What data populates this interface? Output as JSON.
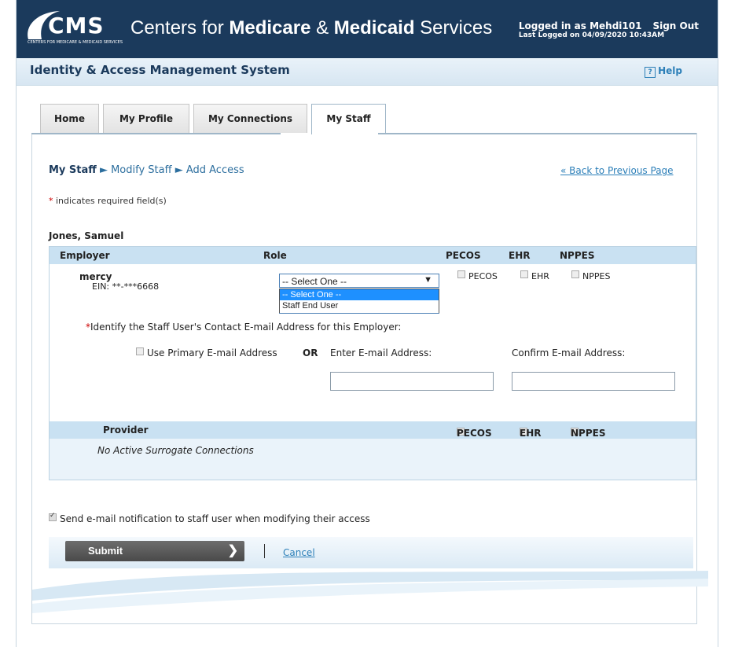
{
  "header": {
    "logo_text": "CMS",
    "logo_subtext": "CENTERS FOR MEDICARE & MEDICAID SERVICES",
    "org_name_part1": "Centers for ",
    "org_name_part2": "Medicare",
    "org_name_part3": " & ",
    "org_name_part4": "Medicaid",
    "org_name_part5": " Services",
    "logged_in": "Logged in as Mehdi101",
    "sign_out": "Sign Out",
    "last_logged": "Last Logged on 04/09/2020 10:43AM"
  },
  "titlebar": {
    "title": "Identity & Access Management System",
    "help_icon": "?",
    "help": "Help"
  },
  "tabs": [
    {
      "label": "Home"
    },
    {
      "label": "My Profile"
    },
    {
      "label": "My Connections"
    },
    {
      "label": "My Staff"
    }
  ],
  "breadcrumb": {
    "root": "My Staff",
    "sep": " ► ",
    "mid": "Modify Staff",
    "leaf": "Add Access"
  },
  "back_link": "« Back to Previous Page",
  "required_note": {
    "star": "*",
    "text": " indicates required field(s)"
  },
  "staff_name": "Jones, Samuel",
  "employer_table": {
    "headers": {
      "employer": "Employer",
      "role": "Role",
      "pecos": "PECOS",
      "ehr": "EHR",
      "nppes": "NPPES"
    },
    "employer_name": "mercy",
    "ein": "EIN: **-***6668",
    "role_select": {
      "value": "-- Select One --",
      "arrow": "▼"
    },
    "role_options": [
      "-- Select One --",
      "Staff End User"
    ],
    "cb_pecos": "PECOS",
    "cb_ehr": "EHR",
    "cb_nppes": "NPPES",
    "email_prompt_star": "*",
    "email_prompt": "Identify the Staff User's Contact E-mail Address for this Employer:",
    "use_primary": "Use Primary E-mail Address",
    "or": "OR",
    "enter_email": "Enter E-mail Address:",
    "confirm_email": "Confirm E-mail Address:",
    "enter_email_value": "",
    "confirm_email_value": ""
  },
  "provider_table": {
    "provider": "Provider",
    "pecos": "PECOS",
    "ehr": "EHR",
    "nppes": "NPPES",
    "empty": "No Active Surrogate Connections"
  },
  "notify": {
    "checked": true,
    "label": "Send e-mail notification to staff user when modifying their access"
  },
  "actions": {
    "submit": "Submit",
    "submit_chev": "❯",
    "cancel": "Cancel"
  },
  "colors": {
    "header_bg": "#1b3a5c",
    "table_head": "#c9e1f2",
    "link": "#2c7fb8"
  }
}
